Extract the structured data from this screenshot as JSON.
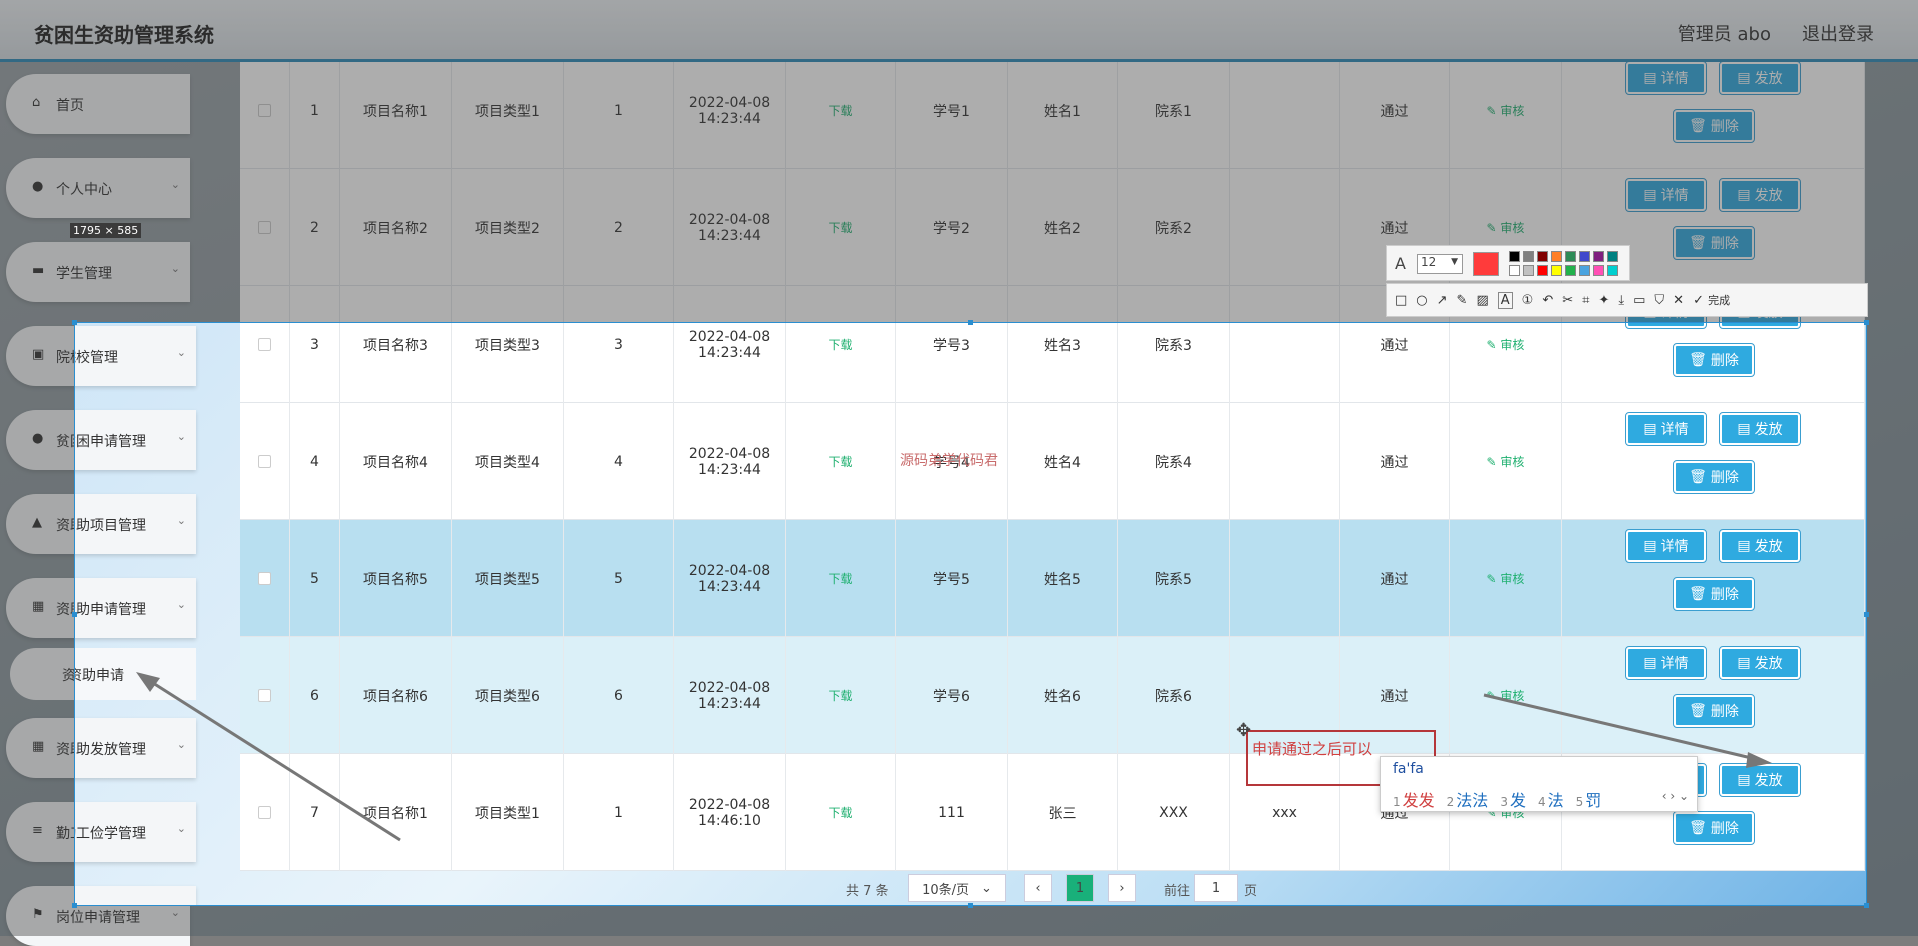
{
  "header": {
    "title": "贫困生资助管理系统",
    "admin": "管理员 abo",
    "logout": "退出登录"
  },
  "sidebar": {
    "items": [
      {
        "label": "首页",
        "icon": "home-icon"
      },
      {
        "label": "个人中心",
        "icon": "person-icon"
      },
      {
        "label": "学生管理",
        "icon": "chat-icon"
      },
      {
        "label": "院校管理",
        "icon": "briefcase-icon"
      },
      {
        "label": "贫困申请管理",
        "icon": "person-icon"
      },
      {
        "label": "资助项目管理",
        "icon": "chart-icon"
      },
      {
        "label": "资助申请管理",
        "icon": "grid-icon"
      },
      {
        "label": "资助发放管理",
        "icon": "grid-icon"
      },
      {
        "label": "勤工俭学管理",
        "icon": "list-icon"
      },
      {
        "label": "岗位申请管理",
        "icon": "flag-icon"
      }
    ],
    "sub_item": "资助申请"
  },
  "size_badge": "1795 × 585",
  "table": {
    "download_label": "下载",
    "review_label": "审核",
    "detail_btn": "详情",
    "issue_btn": "发放",
    "delete_btn": "删除",
    "rows": [
      {
        "idx": "1",
        "name": "项目名称1",
        "type": "项目类型1",
        "num": "1",
        "date": "2022-04-08",
        "time": "14:23:44",
        "sid": "学号1",
        "sname": "姓名1",
        "dept": "院系1",
        "extra": "",
        "status": "通过"
      },
      {
        "idx": "2",
        "name": "项目名称2",
        "type": "项目类型2",
        "num": "2",
        "date": "2022-04-08",
        "time": "14:23:44",
        "sid": "学号2",
        "sname": "姓名2",
        "dept": "院系2",
        "extra": "",
        "status": "通过"
      },
      {
        "idx": "3",
        "name": "项目名称3",
        "type": "项目类型3",
        "num": "3",
        "date": "2022-04-08",
        "time": "14:23:44",
        "sid": "学号3",
        "sname": "姓名3",
        "dept": "院系3",
        "extra": "",
        "status": "通过"
      },
      {
        "idx": "4",
        "name": "项目名称4",
        "type": "项目类型4",
        "num": "4",
        "date": "2022-04-08",
        "time": "14:23:44",
        "sid": "学号4",
        "sname": "姓名4",
        "dept": "院系4",
        "extra": "",
        "status": "通过"
      },
      {
        "idx": "5",
        "name": "项目名称5",
        "type": "项目类型5",
        "num": "5",
        "date": "2022-04-08",
        "time": "14:23:44",
        "sid": "学号5",
        "sname": "姓名5",
        "dept": "院系5",
        "extra": "",
        "status": "通过"
      },
      {
        "idx": "6",
        "name": "项目名称6",
        "type": "项目类型6",
        "num": "6",
        "date": "2022-04-08",
        "time": "14:23:44",
        "sid": "学号6",
        "sname": "姓名6",
        "dept": "院系6",
        "extra": "",
        "status": "通过"
      },
      {
        "idx": "7",
        "name": "项目名称1",
        "type": "项目类型1",
        "num": "1",
        "date": "2022-04-08",
        "time": "14:46:10",
        "sid": "111",
        "sname": "张三",
        "dept": "XXX",
        "extra": "xxx",
        "status": "通过"
      }
    ]
  },
  "watermark": "源码弟学代码君",
  "pager": {
    "total": "共 7 条",
    "page_size": "10条/页",
    "current": "1",
    "goto": "前往",
    "goto_value": "1",
    "page_unit": "页"
  },
  "toolbar": {
    "font_size": "12",
    "done": "完成",
    "current_color": "#ff3b3b"
  },
  "annotation": {
    "text": "申请通过之后可以"
  },
  "ime": {
    "input": "fa'fa",
    "candidates": [
      {
        "n": "1",
        "t": "发发"
      },
      {
        "n": "2",
        "t": "法法"
      },
      {
        "n": "3",
        "t": "发"
      },
      {
        "n": "4",
        "t": "法"
      },
      {
        "n": "5",
        "t": "罚"
      }
    ]
  }
}
